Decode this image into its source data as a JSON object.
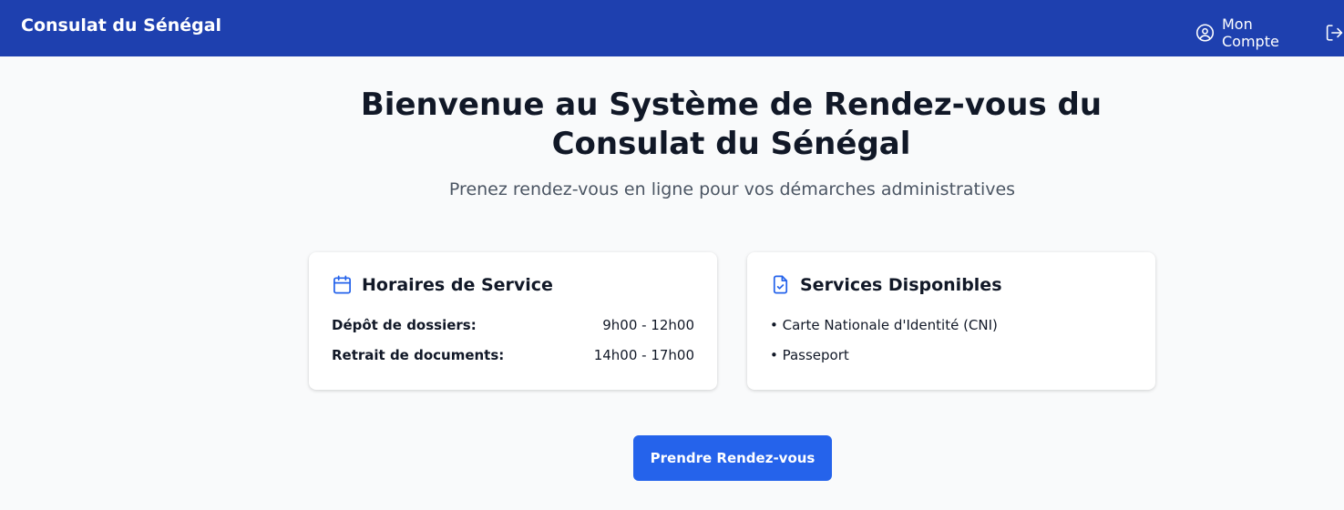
{
  "navbar": {
    "brand": "Consulat du Sénégal",
    "account_label": "Mon Compte",
    "color": "#1e40af"
  },
  "hero": {
    "title": "Bienvenue au Système de Rendez-vous du Consulat du Sénégal",
    "subtitle": "Prenez rendez-vous en ligne pour vos démarches administratives"
  },
  "hours_card": {
    "title": "Horaires de Service",
    "icon": "calendar-icon",
    "rows": [
      {
        "label": "Dépôt de dossiers:",
        "value": "9h00 - 12h00"
      },
      {
        "label": "Retrait de documents:",
        "value": "14h00 - 17h00"
      }
    ]
  },
  "services_card": {
    "title": "Services Disponibles",
    "icon": "document-check-icon",
    "items": [
      "• Carte Nationale d'Identité (CNI)",
      "• Passeport"
    ]
  },
  "cta": {
    "label": "Prendre Rendez-vous",
    "color": "#2563eb"
  }
}
